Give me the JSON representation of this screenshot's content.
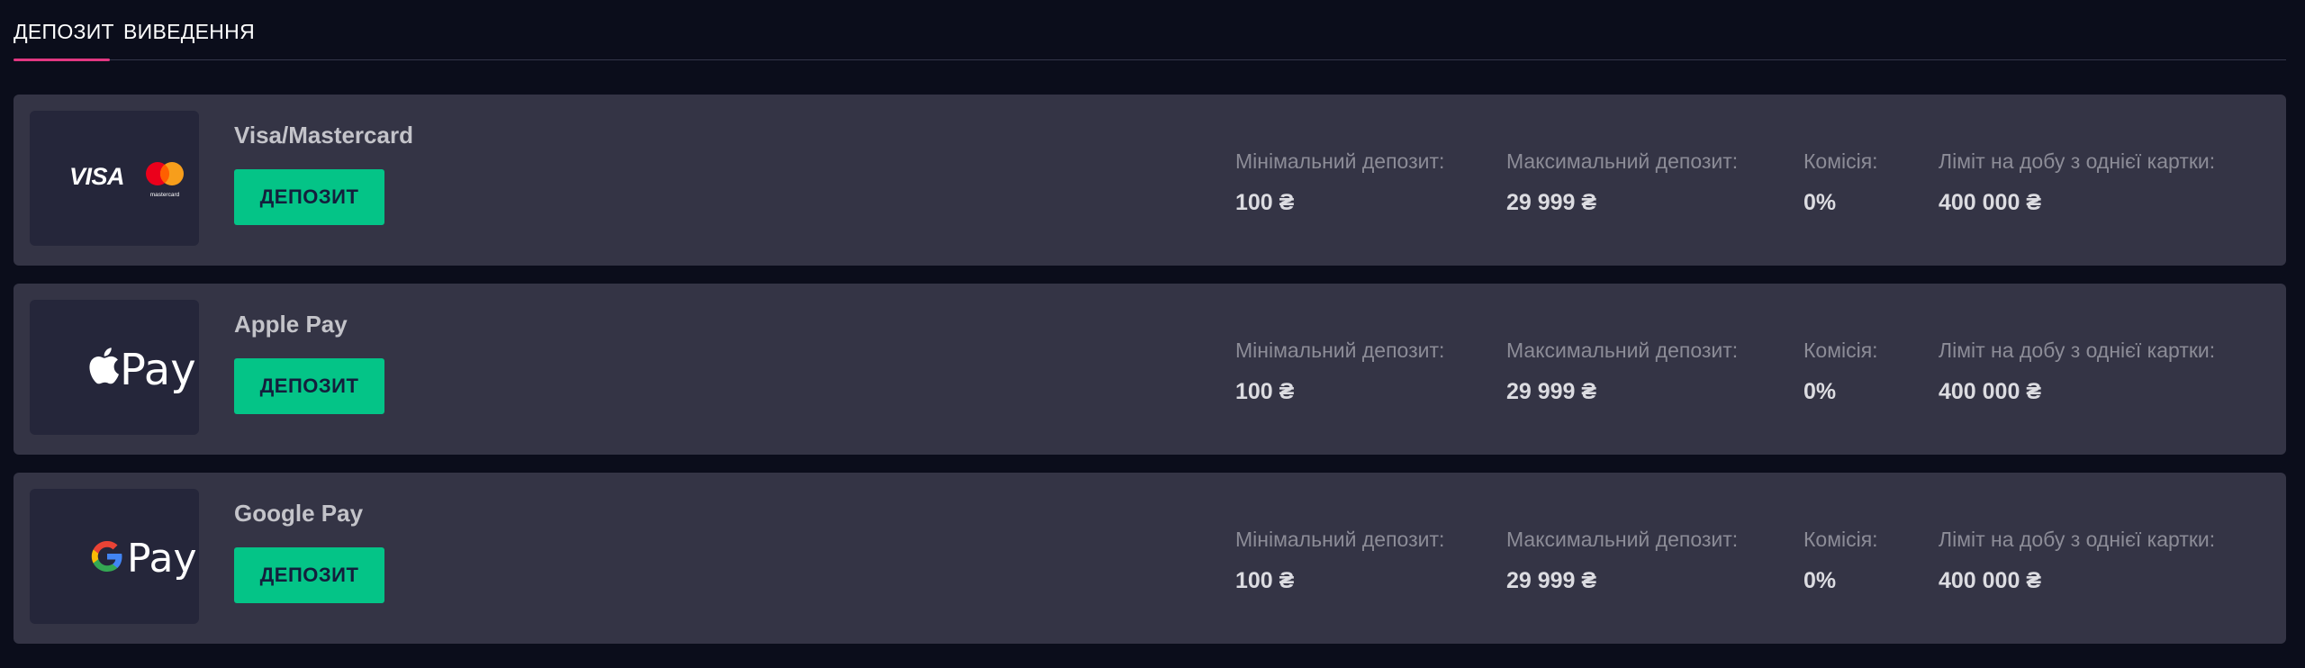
{
  "tabs": {
    "deposit": "ДЕПОЗИТ",
    "withdraw": "ВИВЕДЕННЯ",
    "active": "deposit"
  },
  "labels": {
    "min_deposit": "Мінімальний депозит:",
    "max_deposit": "Максимальний депозит:",
    "commission": "Комісія:",
    "daily_limit": "Ліміт на добу з однієї картки:",
    "deposit_button": "ДЕПОЗИТ"
  },
  "methods": [
    {
      "name": "Visa/Mastercard",
      "logo": "visa-mastercard",
      "logo_text": "VISA",
      "logo_subtext": "mastercard",
      "min_deposit": "100 ₴",
      "max_deposit": "29 999 ₴",
      "commission": "0%",
      "daily_limit": "400 000 ₴"
    },
    {
      "name": "Apple Pay",
      "logo": "apple-pay",
      "logo_text": "Pay",
      "min_deposit": "100 ₴",
      "max_deposit": "29 999 ₴",
      "commission": "0%",
      "daily_limit": "400 000 ₴"
    },
    {
      "name": "Google Pay",
      "logo": "google-pay",
      "logo_text": "Pay",
      "min_deposit": "100 ₴",
      "max_deposit": "29 999 ₴",
      "commission": "0%",
      "daily_limit": "400 000 ₴"
    }
  ],
  "colors": {
    "background": "#0b0d1b",
    "row": "#343445",
    "logo_box": "#25263a",
    "button": "#04c487",
    "button_text": "#141e3c",
    "tab_accent": "#e23782"
  }
}
